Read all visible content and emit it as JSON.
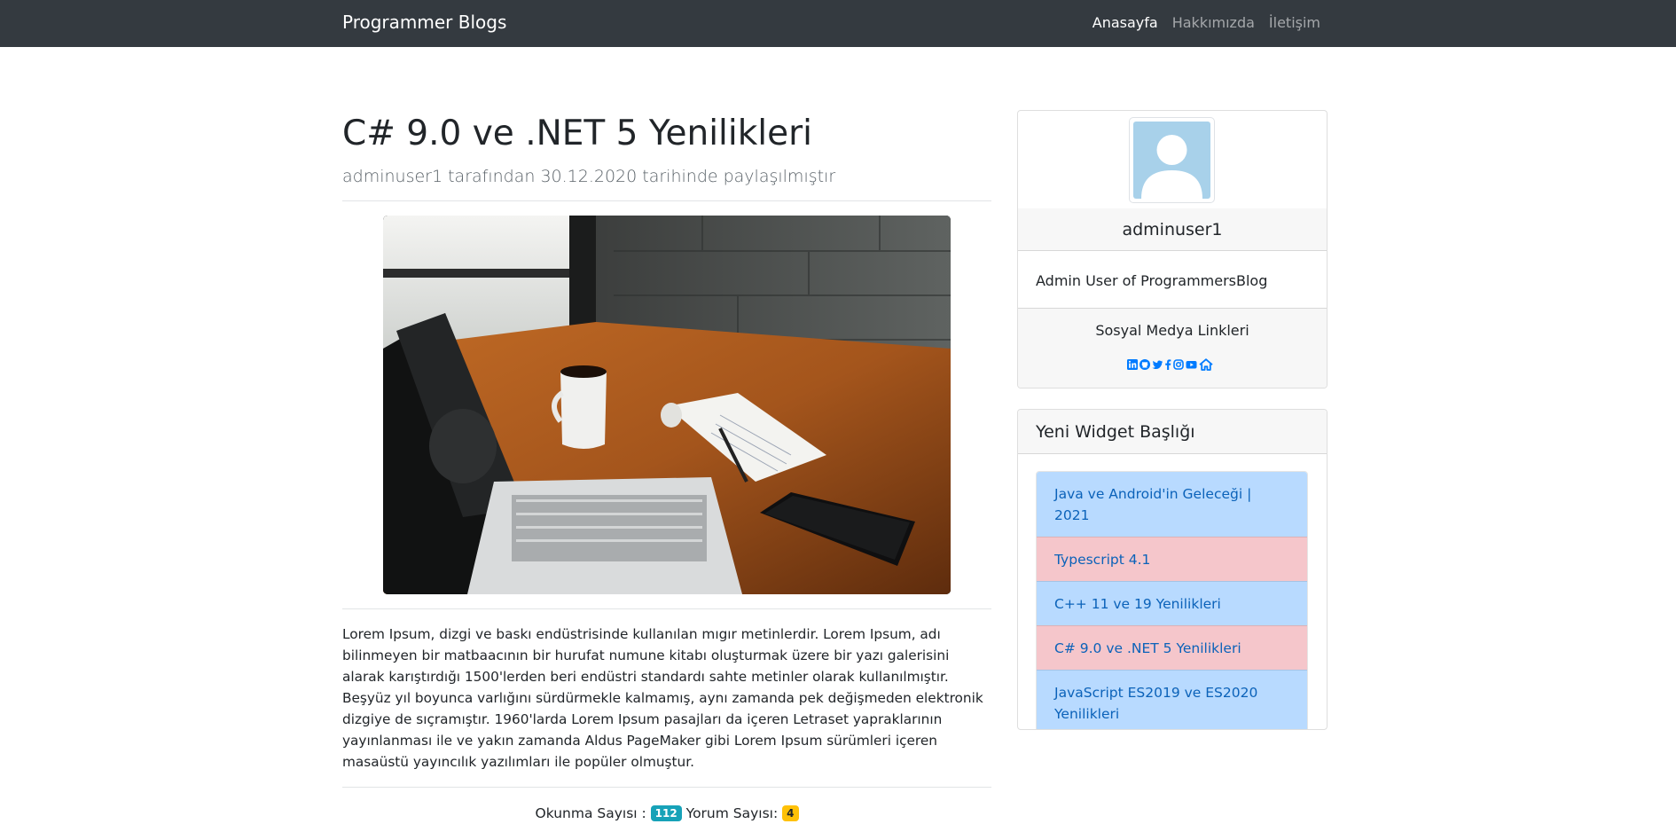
{
  "navbar": {
    "brand": "Programmer Blogs",
    "links": [
      {
        "label": "Anasayfa",
        "active": true
      },
      {
        "label": "Hakkımızda",
        "active": false
      },
      {
        "label": "İletişim",
        "active": false
      }
    ]
  },
  "post": {
    "title": "C# 9.0 ve .NET 5 Yenilikleri",
    "meta": "adminuser1 tarafından 30.12.2020 tarihinde paylaşılmıştır",
    "body": "Lorem Ipsum, dizgi ve baskı endüstrisinde kullanılan mıgır metinlerdir. Lorem Ipsum, adı bilinmeyen bir matbaacının bir hurufat numune kitabı oluşturmak üzere bir yazı galerisini alarak karıştırdığı 1500'lerden beri endüstri standardı sahte metinler olarak kullanılmıştır. Beşyüz yıl boyunca varlığını sürdürmekle kalmamış, aynı zamanda pek değişmeden elektronik dizgiye de sıçramıştır. 1960'larda Lorem Ipsum pasajları da içeren Letraset yapraklarının yayınlanması ile ve yakın zamanda Aldus PageMaker gibi Lorem Ipsum sürümleri içeren masaüstü yayıncılık yazılımları ile popüler olmuştur.",
    "stats": {
      "read_label": "Okunma Sayısı :",
      "read_count": "112",
      "comment_label": "Yorum Sayısı:",
      "comment_count": "4"
    }
  },
  "profile": {
    "name": "adminuser1",
    "description": "Admin User of ProgrammersBlog",
    "social_title": "Sosyal Medya Linkleri",
    "social_icons": [
      "linkedin-icon",
      "github-icon",
      "twitter-icon",
      "facebook-icon",
      "instagram-icon",
      "youtube-icon",
      "website-home-icon"
    ]
  },
  "widget": {
    "title": "Yeni Widget Başlığı",
    "items": [
      {
        "label": "Java ve Android'in Geleceği | 2021",
        "variant": "blue"
      },
      {
        "label": "Typescript 4.1",
        "variant": "red"
      },
      {
        "label": "C++ 11 ve 19 Yenilikleri",
        "variant": "blue"
      },
      {
        "label": "C# 9.0 ve .NET 5 Yenilikleri",
        "variant": "red"
      },
      {
        "label": "JavaScript ES2019 ve ES2020 Yenilikleri",
        "variant": "blue"
      }
    ]
  },
  "colors": {
    "navbar": "#343a40",
    "link_primary": "#007bff",
    "badge_info": "#17a2b8",
    "badge_warning": "#ffc107",
    "list_blue": "#b8daff",
    "list_red": "#f5c6cb"
  }
}
